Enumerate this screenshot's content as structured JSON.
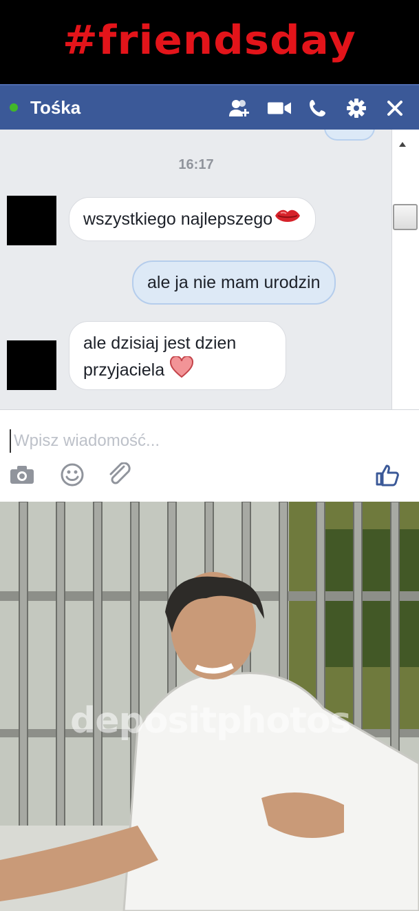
{
  "banner": {
    "title": "#friendsday",
    "color": "#e3141a"
  },
  "chat": {
    "contact_name": "Tośka",
    "presence_color": "#42b72a",
    "header_color": "#3b5998",
    "header_icons": [
      "add-friend-icon",
      "video-call-icon",
      "phone-icon",
      "settings-gear-icon",
      "close-icon"
    ],
    "timestamp": "16:17",
    "messages": [
      {
        "sender": "contact",
        "text": "wszystkiego najlepszego",
        "emoji": "kiss-lips-icon"
      },
      {
        "sender": "me",
        "text": "ale ja nie mam urodzin"
      },
      {
        "sender": "contact",
        "line1": "ale dzisiaj jest dzien",
        "line2": "przyjaciela",
        "emoji": "heart-icon"
      }
    ],
    "composer": {
      "placeholder": "Wpisz wiadomość...",
      "tool_icons": [
        "camera-icon",
        "smiley-icon",
        "paperclip-icon",
        "thumbs-up-icon"
      ]
    }
  },
  "photo": {
    "watermark": "depositphotos"
  }
}
